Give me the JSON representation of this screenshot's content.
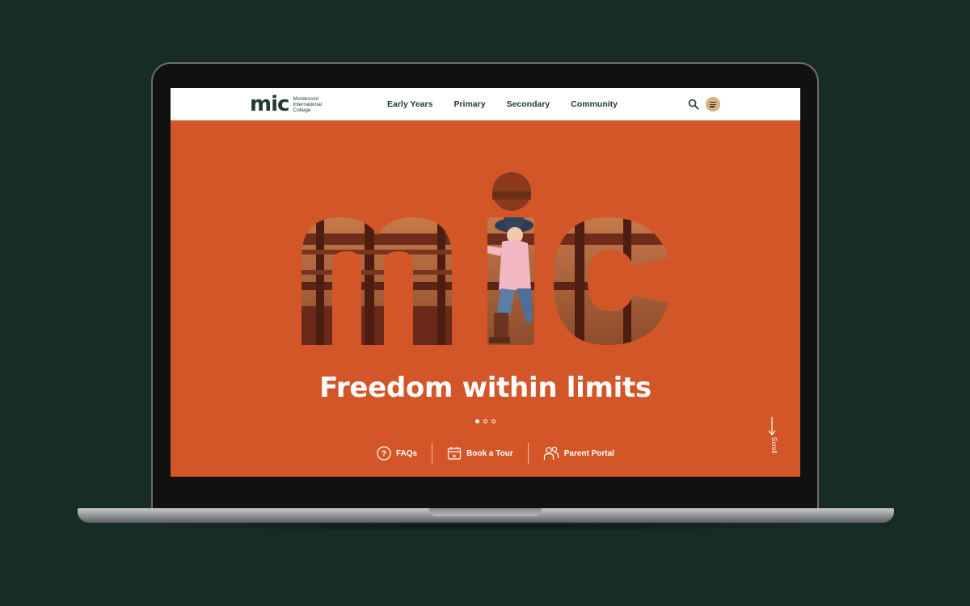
{
  "brand": {
    "logo_text": "mic",
    "logo_subtitle": "Montessori International College"
  },
  "nav": {
    "items": [
      {
        "label": "Early Years"
      },
      {
        "label": "Primary"
      },
      {
        "label": "Secondary"
      },
      {
        "label": "Community"
      }
    ]
  },
  "header_icons": [
    "search-icon",
    "menu-icon"
  ],
  "hero": {
    "headline": "Freedom within limits",
    "slides": 3,
    "active_slide": 1
  },
  "quick_links": [
    {
      "label": "FAQs",
      "icon": "question-icon"
    },
    {
      "label": "Book a Tour",
      "icon": "calendar-icon"
    },
    {
      "label": "Parent Portal",
      "icon": "people-icon"
    }
  ],
  "scroll": {
    "label": "Scroll"
  },
  "colors": {
    "page_background": "#172c25",
    "hero_background": "#d35628",
    "brand_dark": "#1f3a30",
    "menu_button": "#d8b182",
    "text_on_hero": "#ffffff"
  }
}
